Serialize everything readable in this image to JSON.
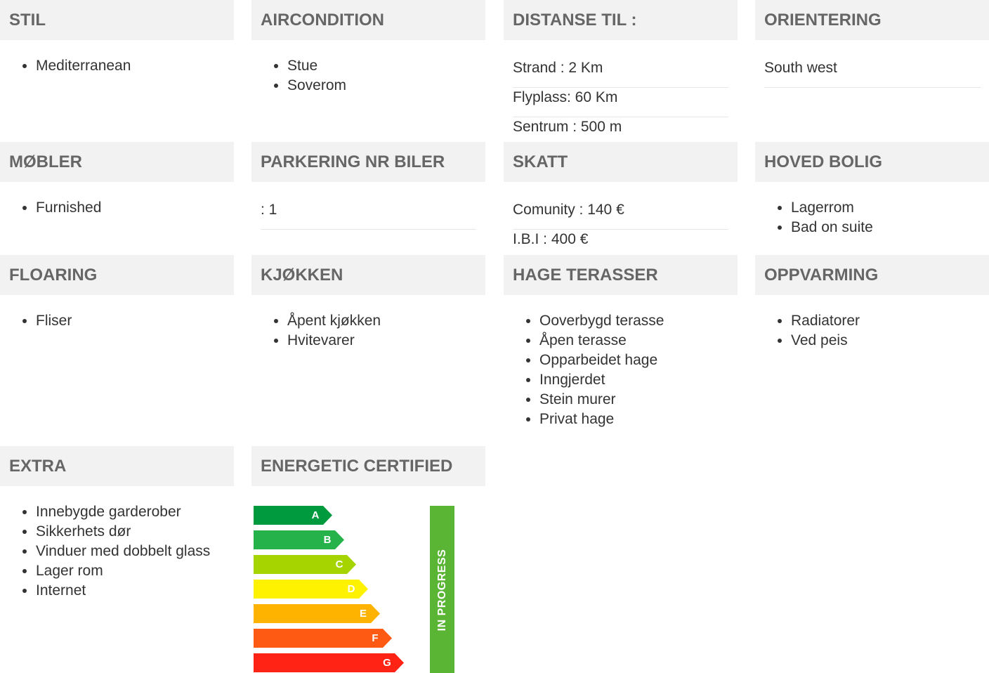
{
  "sections": {
    "stil": {
      "title": "STIL",
      "items": [
        "Mediterranean"
      ]
    },
    "aircondition": {
      "title": "AIRCONDITION",
      "items": [
        "Stue",
        "Soverom"
      ]
    },
    "distanse": {
      "title": "DISTANSE TIL :",
      "rows": [
        "Strand : 2 Km",
        "Flyplass: 60 Km",
        "Sentrum : 500 m"
      ]
    },
    "orientering": {
      "title": "ORIENTERING",
      "rows": [
        "South west"
      ]
    },
    "mobler": {
      "title": "MØBLER",
      "items": [
        "Furnished"
      ]
    },
    "parkering": {
      "title": "PARKERING NR BILER",
      "rows": [
        ": 1"
      ]
    },
    "skatt": {
      "title": "SKATT",
      "rows": [
        "Comunity : 140 €",
        "I.B.I : 400 €"
      ]
    },
    "hoved_bolig": {
      "title": "HOVED BOLIG",
      "items": [
        "Lagerrom",
        "Bad on suite"
      ]
    },
    "floaring": {
      "title": "FLOARING",
      "items": [
        "Fliser"
      ]
    },
    "kjokken": {
      "title": "KJØKKEN",
      "items": [
        "Åpent kjøkken",
        "Hvitevarer"
      ]
    },
    "hage": {
      "title": "HAGE TERASSER",
      "items": [
        "Ooverbygd terasse",
        "Åpen terasse",
        "Opparbeidet hage",
        "Inngjerdet",
        "Stein murer",
        "Privat hage"
      ]
    },
    "oppvarming": {
      "title": "OPPVARMING",
      "items": [
        "Radiatorer",
        "Ved peis"
      ]
    },
    "extra": {
      "title": "EXTRA",
      "items": [
        "Innebygde garderober",
        "Sikkerhets dør",
        "Vinduer med dobbelt glass",
        "Lager rom",
        "Internet"
      ]
    },
    "energy": {
      "title": "ENERGETIC CERTIFIED",
      "status": "IN PROGRESS",
      "status_color": "#5ab534",
      "classes": [
        {
          "letter": "A",
          "color": "#009a3e"
        },
        {
          "letter": "B",
          "color": "#26b24b"
        },
        {
          "letter": "C",
          "color": "#a6d400"
        },
        {
          "letter": "D",
          "color": "#fff200"
        },
        {
          "letter": "E",
          "color": "#fdb300"
        },
        {
          "letter": "F",
          "color": "#ff5a13"
        },
        {
          "letter": "G",
          "color": "#ff2316"
        }
      ]
    }
  }
}
